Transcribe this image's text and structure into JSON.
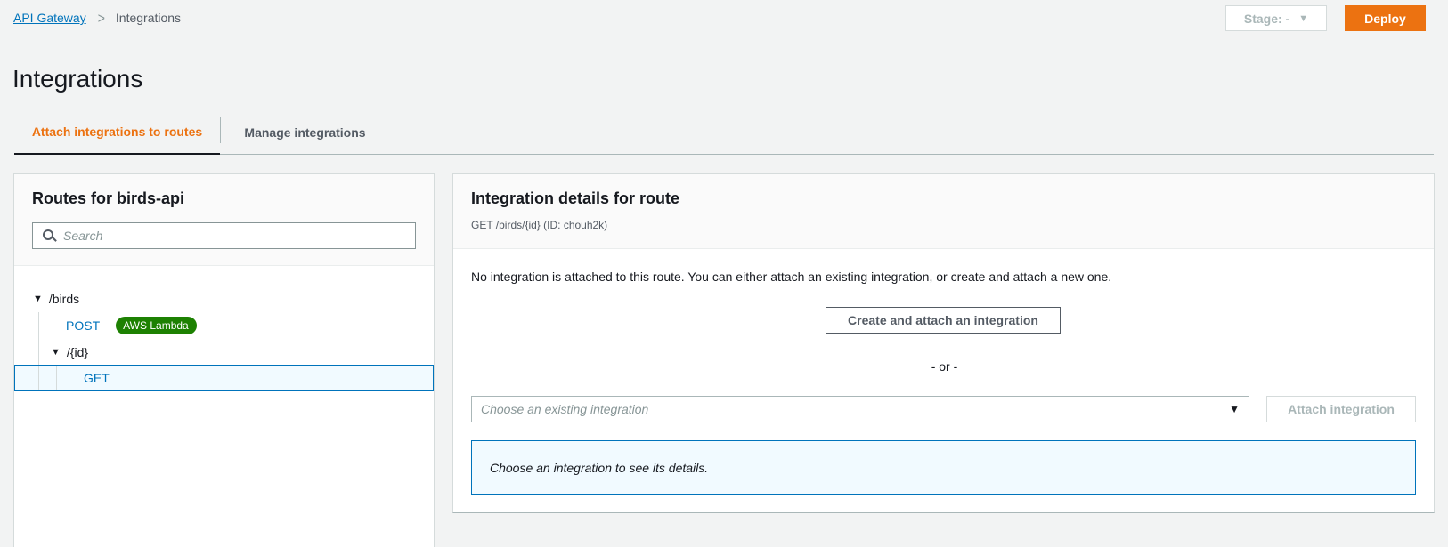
{
  "breadcrumb": {
    "root": "API Gateway",
    "current": "Integrations"
  },
  "header": {
    "stage_label": "Stage: -",
    "deploy_label": "Deploy"
  },
  "page": {
    "title": "Integrations"
  },
  "tabs": [
    {
      "label": "Attach integrations to routes",
      "active": true
    },
    {
      "label": "Manage integrations",
      "active": false
    }
  ],
  "routes_panel": {
    "title": "Routes for birds-api",
    "search_placeholder": "Search",
    "tree": {
      "birds": "/birds",
      "post_method": "POST",
      "post_badge": "AWS Lambda",
      "id_path": "/{id}",
      "get_method": "GET"
    }
  },
  "details_panel": {
    "title": "Integration details for route",
    "route_subtitle": "GET /birds/{id} (ID: chouh2k)",
    "info_text": "No integration is attached to this route. You can either attach an existing integration, or create and attach a new one.",
    "create_button": "Create and attach an integration",
    "or_text": "- or -",
    "existing_placeholder": "Choose an existing integration",
    "attach_button": "Attach integration",
    "info_box_text": "Choose an integration to see its details."
  },
  "colors": {
    "accent": "#ec7211",
    "link": "#0073bb",
    "badge_green": "#1d8102",
    "selected_bg": "#f1faff"
  }
}
